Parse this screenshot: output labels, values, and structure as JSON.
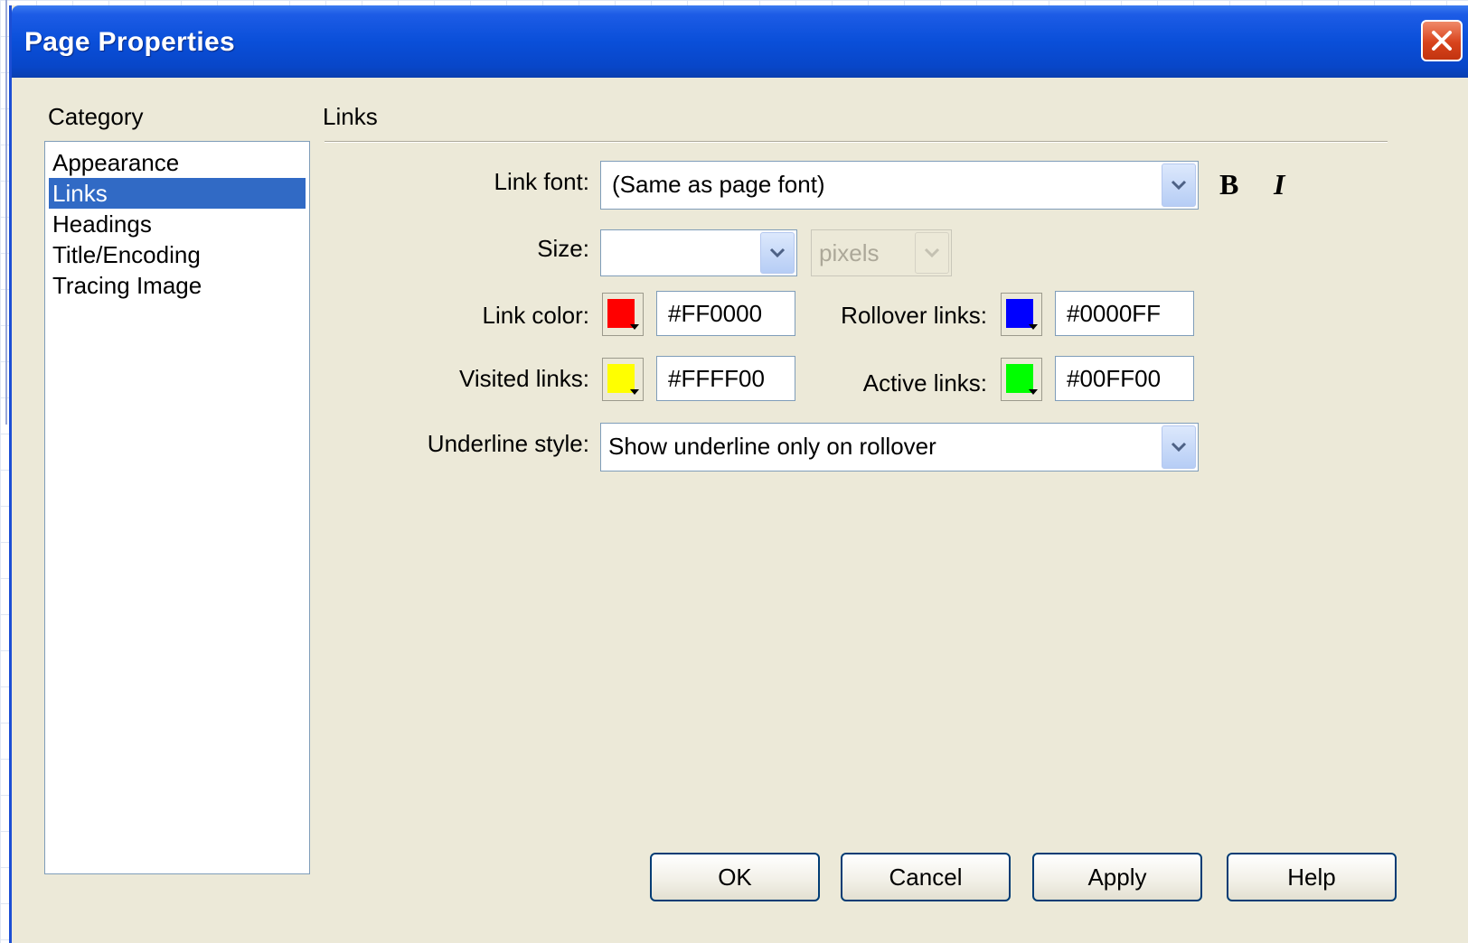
{
  "window": {
    "title": "Page Properties"
  },
  "category": {
    "label": "Category",
    "items": [
      {
        "label": "Appearance",
        "selected": false
      },
      {
        "label": "Links",
        "selected": true
      },
      {
        "label": "Headings",
        "selected": false
      },
      {
        "label": "Title/Encoding",
        "selected": false
      },
      {
        "label": "Tracing Image",
        "selected": false
      }
    ]
  },
  "panel": {
    "heading": "Links",
    "link_font": {
      "label": "Link font:",
      "value": "(Same as page font)"
    },
    "bold_label": "B",
    "italic_label": "I",
    "size": {
      "label": "Size:",
      "value": "",
      "unit": "pixels"
    },
    "link_color": {
      "label": "Link color:",
      "value": "#FF0000",
      "swatch": "#FF0000"
    },
    "rollover_links": {
      "label": "Rollover links:",
      "value": "#0000FF",
      "swatch": "#0000FF"
    },
    "visited_links": {
      "label": "Visited links:",
      "value": "#FFFF00",
      "swatch": "#FFFF00"
    },
    "active_links": {
      "label": "Active links:",
      "value": "#00FF00",
      "swatch": "#00FF00"
    },
    "underline_style": {
      "label": "Underline style:",
      "value": "Show underline only on rollover"
    }
  },
  "buttons": {
    "ok": "OK",
    "cancel": "Cancel",
    "apply": "Apply",
    "help": "Help"
  },
  "icons": {
    "close": "close-icon",
    "dropdown": "chevron-down-icon"
  },
  "colors": {
    "titlebar": "#0A4FD9",
    "selection": "#316AC5",
    "dialog_bg": "#ECE9D8"
  }
}
